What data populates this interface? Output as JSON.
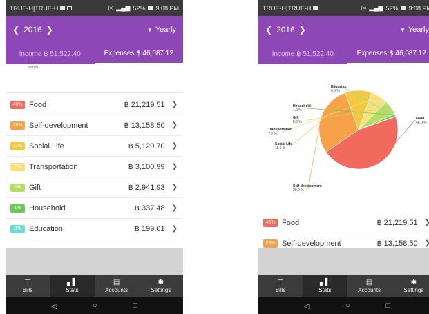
{
  "status_bar": {
    "carrier_left": "TRUE-H|TRUE-H",
    "carrier_right": "TRUE-H|TRUE-H",
    "battery": "52%",
    "time": "9:08 PM"
  },
  "header": {
    "year": "2016",
    "period": "Yearly"
  },
  "tabs": {
    "income": "Income ฿ 51,522.40",
    "expenses": "Expenses ฿ 46,087.12"
  },
  "peek_label": "29.0 %",
  "categories": [
    {
      "pct": "46%",
      "name": "Food",
      "amount": "฿ 21,219.51",
      "color": "#f26a5e"
    },
    {
      "pct": "29%",
      "name": "Self-development",
      "amount": "฿ 13,158.50",
      "color": "#f7a24a"
    },
    {
      "pct": "11%",
      "name": "Social Life",
      "amount": "฿ 5,129.70",
      "color": "#f5c842"
    },
    {
      "pct": "7%",
      "name": "Transportation",
      "amount": "฿ 3,100.99",
      "color": "#f6e27c"
    },
    {
      "pct": "6%",
      "name": "Gift",
      "amount": "฿ 2,941.93",
      "color": "#b9dc64"
    },
    {
      "pct": "1%",
      "name": "Household",
      "amount": "฿ 337.48",
      "color": "#6cc759"
    },
    {
      "pct": "0%",
      "name": "Education",
      "amount": "฿ 199.01",
      "color": "#6fdbd6"
    }
  ],
  "chart_data": {
    "type": "pie",
    "labels": [
      "Food",
      "Self-development",
      "Social Life",
      "Transportation",
      "Gift",
      "Household",
      "Education"
    ],
    "values": [
      46.0,
      29.0,
      11.0,
      7.0,
      6.0,
      1.0,
      0.0
    ],
    "value_labels": [
      "46.0 %",
      "29.0 %",
      "11.0 %",
      "7.0 %",
      "6.0 %",
      "1.0 %",
      "0.0 %"
    ],
    "colors": [
      "#f26a5e",
      "#f7a24a",
      "#f5c842",
      "#f6e27c",
      "#b9dc64",
      "#6cc759",
      "#6fdbd6"
    ]
  },
  "bottom_nav": [
    {
      "label": "Bills",
      "icon": "list-icon"
    },
    {
      "label": "Stats",
      "icon": "bar-chart-icon"
    },
    {
      "label": "Accounts",
      "icon": "wallet-icon"
    },
    {
      "label": "Settings",
      "icon": "gear-icon"
    }
  ],
  "system_nav": [
    "back-icon",
    "home-icon",
    "recents-icon"
  ],
  "colors": {
    "header": "#8d47b6",
    "nav": "#3b3b3b"
  }
}
